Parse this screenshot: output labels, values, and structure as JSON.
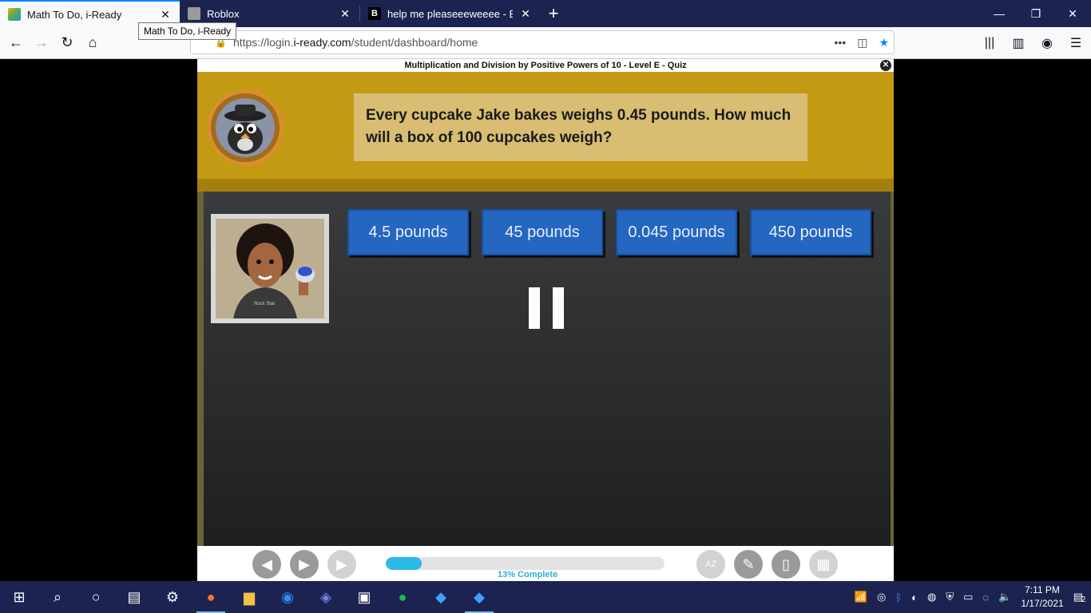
{
  "browser": {
    "tabs": [
      {
        "title": "Math To Do, i-Ready",
        "active": true
      },
      {
        "title": "Roblox",
        "active": false
      },
      {
        "title": "help me pleaseeeweeee - Brainl",
        "active": false
      }
    ],
    "tooltip": "Math To Do, i-Ready",
    "url_prefix": "https://login.",
    "url_domain": "i-ready.com",
    "url_path": "/student/dashboard/home"
  },
  "lesson": {
    "title": "Multiplication and Division by Positive Powers of 10 - Level E - Quiz",
    "question": "Every cupcake Jake bakes weighs 0.45 pounds. How much will a box of 100 cupcakes weigh?",
    "answers": [
      "4.5 pounds",
      "45 pounds",
      "0.045 pounds",
      "450 pounds"
    ],
    "progress_percent": 13,
    "progress_label": "13% Complete"
  },
  "taskbar": {
    "time": "7:11 PM",
    "date": "1/17/2021",
    "notification_count": "2"
  },
  "colors": {
    "accent": "#0a84ff",
    "banner": "#c39a14",
    "answer_button": "#2466c0",
    "progress": "#2bbbe6",
    "taskbar": "#1c2350"
  }
}
